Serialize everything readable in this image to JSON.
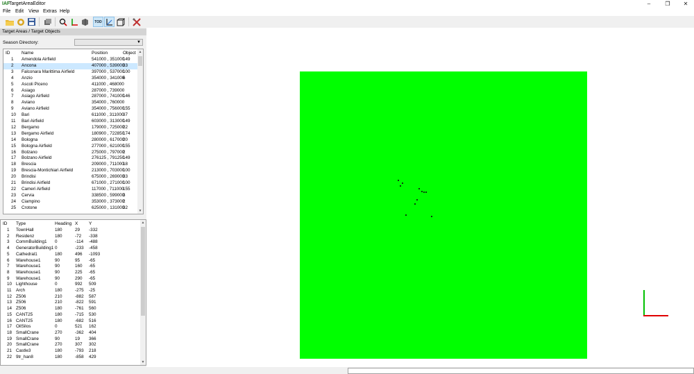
{
  "window": {
    "title": "TargetAreaEditor",
    "app_icon": "IAF",
    "minimize": "–",
    "maximize": "❐",
    "close": "✕"
  },
  "menu": [
    "File",
    "Edit",
    "View",
    "Extras",
    "Help"
  ],
  "toolbar": {
    "icons": [
      "open-folder-icon",
      "reload-icon",
      "save-icon",
      "layers-icon",
      "zoom-area-icon",
      "axis-arrows-icon",
      "object-icon",
      "tod-icon",
      "axis-corner-icon",
      "cube-icon",
      "tools-icon"
    ],
    "tod_label": "TOD"
  },
  "panel": {
    "title": "Target Areas / Target Objects",
    "season_label": "Season Directory:",
    "season_value": ""
  },
  "areas": {
    "columns": [
      "ID",
      "Name",
      "Position",
      "Object"
    ],
    "selected_index": 1,
    "rows": [
      [
        "1",
        "Amendola Airfield",
        "541000 , 351000",
        "149"
      ],
      [
        "2",
        "Ancona",
        "407000 , 539000",
        "33"
      ],
      [
        "3",
        "Falconara Marittima Airfield",
        "397000 , 537000",
        "100"
      ],
      [
        "4",
        "Anzio",
        "354000 , 341000",
        "6"
      ],
      [
        "5",
        "Ascoli Piceno",
        "411000 , 468000",
        ""
      ],
      [
        "6",
        "Asiago",
        "287000 , 739000",
        ""
      ],
      [
        "7",
        "Asiago Airfield",
        "287000 , 741000",
        "146"
      ],
      [
        "8",
        "Aviano",
        "354000 , 760000",
        ""
      ],
      [
        "9",
        "Aviano Airfield",
        "354000 , 756000",
        "155"
      ],
      [
        "10",
        "Bari",
        "611000 , 311000",
        "37"
      ],
      [
        "11",
        "Bari Airfield",
        "603000 , 313000",
        "149"
      ],
      [
        "12",
        "Bergamo",
        "179000 , 725000",
        "22"
      ],
      [
        "13",
        "Bergamo Airfield",
        "180900 , 722850",
        "174"
      ],
      [
        "14",
        "Bologna",
        "280000 , 617000",
        "20"
      ],
      [
        "15",
        "Bologna Airfield",
        "277000 , 621000",
        "155"
      ],
      [
        "16",
        "Bolzano",
        "275000 , 797000",
        "2"
      ],
      [
        "17",
        "Bolzano Airfield",
        "276125 , 791250",
        "149"
      ],
      [
        "18",
        "Brescia",
        "209000 , 711000",
        "18"
      ],
      [
        "19",
        "Brescia-Montichiari Airfield",
        "213000 , 703000",
        "100"
      ],
      [
        "20",
        "Brindisi",
        "675000 , 269000",
        "33"
      ],
      [
        "21",
        "Brindisi Airfield",
        "671000 , 271000",
        "100"
      ],
      [
        "22",
        "Cameri Airfield",
        "117000 , 711000",
        "155"
      ],
      [
        "23",
        "Cervia",
        "338500 , 599000",
        "3"
      ],
      [
        "24",
        "Ciampino",
        "353000 , 373000",
        "2"
      ],
      [
        "25",
        "Crotone",
        "625000 , 131000",
        "32"
      ]
    ]
  },
  "objects": {
    "columns": [
      "ID",
      "Type",
      "Heading",
      "X",
      "Y"
    ],
    "rows": [
      [
        "1",
        "TownHall",
        "180",
        "29",
        "-332"
      ],
      [
        "2",
        "Residenz",
        "180",
        "-72",
        "-338"
      ],
      [
        "3",
        "CommBuilding1",
        "0",
        "-114",
        "-488"
      ],
      [
        "4",
        "GeneratorBuilding1",
        "0",
        "-233",
        "-458"
      ],
      [
        "5",
        "Cathedral1",
        "180",
        "496",
        "-1093"
      ],
      [
        "6",
        "Warehouse1",
        "90",
        "95",
        "-65"
      ],
      [
        "7",
        "Warehouse1",
        "90",
        "160",
        "-65"
      ],
      [
        "8",
        "Warehouse1",
        "90",
        "225",
        "-65"
      ],
      [
        "9",
        "Warehouse1",
        "90",
        "290",
        "-65"
      ],
      [
        "10",
        "Lighthouse",
        "0",
        "992",
        "509"
      ],
      [
        "11",
        "Arch",
        "180",
        "-275",
        "-25"
      ],
      [
        "12",
        "Z506",
        "210",
        "-882",
        "587"
      ],
      [
        "13",
        "Z506",
        "210",
        "-822",
        "591"
      ],
      [
        "14",
        "Z506",
        "180",
        "-761",
        "560"
      ],
      [
        "15",
        "CANT25",
        "180",
        "-715",
        "530"
      ],
      [
        "16",
        "CANT25",
        "180",
        "-682",
        "516"
      ],
      [
        "17",
        "OilSilos",
        "0",
        "521",
        "162"
      ],
      [
        "18",
        "SmallCrane",
        "270",
        "-362",
        "404"
      ],
      [
        "19",
        "SmallCrane",
        "90",
        "19",
        "366"
      ],
      [
        "20",
        "SmallCrane",
        "270",
        "307",
        "302"
      ],
      [
        "21",
        "Castle3",
        "180",
        "-793",
        "218"
      ],
      [
        "22",
        "9tr_han8",
        "180",
        "-858",
        "429"
      ]
    ]
  },
  "map": {
    "background": "#00ff00",
    "axis_y_color": "#00c000",
    "axis_x_color": "#e00000"
  }
}
